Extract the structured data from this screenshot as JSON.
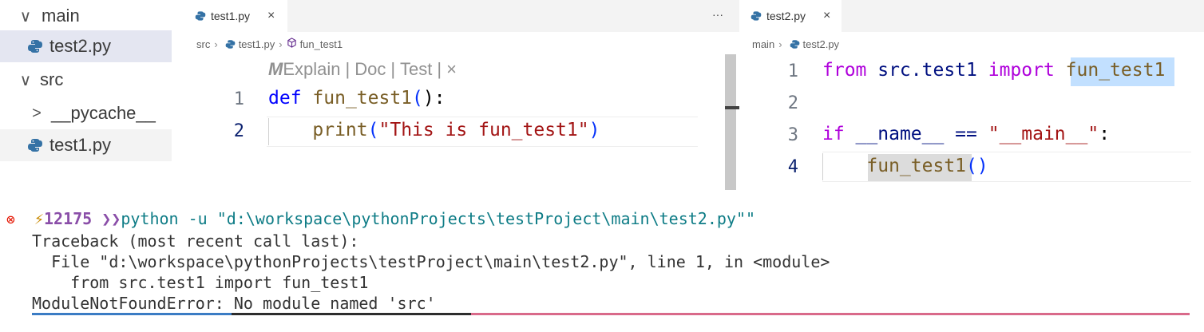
{
  "explorer": {
    "items": [
      {
        "chevron": "∨",
        "label": "main",
        "kind": "folder"
      },
      {
        "chevron": "",
        "label": "test2.py",
        "kind": "file"
      },
      {
        "chevron": "∨",
        "label": "src",
        "kind": "folder"
      },
      {
        "chevron": ">",
        "label": "__pycache__",
        "kind": "folder"
      },
      {
        "chevron": "",
        "label": "test1.py",
        "kind": "file"
      }
    ]
  },
  "left_editor": {
    "tab_label": "test1.py",
    "tab_close": "×",
    "more_actions": "···",
    "breadcrumb": {
      "folder": "src",
      "file": "test1.py",
      "symbol": "fun_test1"
    },
    "codelens": {
      "explain": "Explain",
      "doc": "Doc",
      "test": "Test",
      "sep": "|",
      "close": "×"
    },
    "lines": [
      {
        "number": "1",
        "tokens": [
          "def",
          " ",
          "fun_test1",
          "(",
          "):"
        ]
      },
      {
        "number": "2",
        "tokens": [
          "    ",
          "print",
          "(",
          "\"This is fun_test1\"",
          ")"
        ]
      }
    ]
  },
  "right_editor": {
    "tab_label": "test2.py",
    "tab_close": "×",
    "breadcrumb": {
      "folder": "main",
      "file": "test2.py"
    },
    "lines": [
      {
        "number": "1",
        "tokens": [
          "from",
          " src.test1 ",
          "import",
          " ",
          "fun_test1"
        ]
      },
      {
        "number": "2",
        "tokens": []
      },
      {
        "number": "3",
        "tokens": [
          "if",
          " __name__ == ",
          "\"__main__\"",
          ":"
        ]
      },
      {
        "number": "4",
        "tokens": [
          "    ",
          "fun_test1",
          "()"
        ]
      }
    ]
  },
  "terminal": {
    "error_icon": "⊗",
    "prompt_icon": "⚡",
    "prompt_number": "12175",
    "prompt_arrows": "❯❯",
    "command": "python -u \"d:\\workspace\\pythonProjects\\testProject\\main\\test2.py\"\"",
    "output": [
      "Traceback (most recent call last):",
      "  File \"d:\\workspace\\pythonProjects\\testProject\\main\\test2.py\", line 1, in <module>",
      "    from src.test1 import fun_test1",
      "ModuleNotFoundError: No module named 'src'"
    ]
  },
  "colors": {
    "keyword": "#0000ff",
    "control_keyword": "#af00db",
    "function": "#795e26",
    "string": "#a31515",
    "selection": "#add6ff",
    "error": "#e51400"
  },
  "icons": {
    "python_file": "python-file-icon",
    "symbol": "cube-icon",
    "error": "error-circle-icon",
    "prompt": "lightning-icon"
  }
}
